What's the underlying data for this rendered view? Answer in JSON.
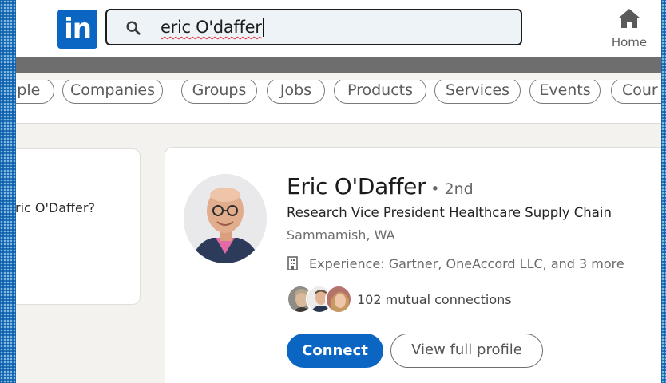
{
  "header": {
    "logo_text": "in",
    "search": {
      "value": "eric O'daffer",
      "icon": "search-icon"
    },
    "nav": [
      {
        "label": "Home",
        "icon": "home-icon"
      }
    ]
  },
  "filters": [
    {
      "label": "ople"
    },
    {
      "label": "Companies"
    },
    {
      "label": "Groups"
    },
    {
      "label": "Jobs"
    },
    {
      "label": "Products"
    },
    {
      "label": "Services"
    },
    {
      "label": "Events"
    },
    {
      "label": "Cour"
    }
  ],
  "side_card": {
    "text": "ric O'Daffer?"
  },
  "result": {
    "name": "Eric O'Daffer",
    "degree": "• 2nd",
    "headline": "Research Vice President Healthcare Supply Chain",
    "location": "Sammamish, WA",
    "experience": "Experience: Gartner, OneAccord LLC, and 3 more",
    "mutual": "102 mutual connections",
    "actions": {
      "connect": "Connect",
      "view_profile": "View full profile"
    }
  },
  "colors": {
    "brand": "#0a66c2",
    "page_bg": "#f3f2ef",
    "frame_pattern": "#1e73bd"
  }
}
